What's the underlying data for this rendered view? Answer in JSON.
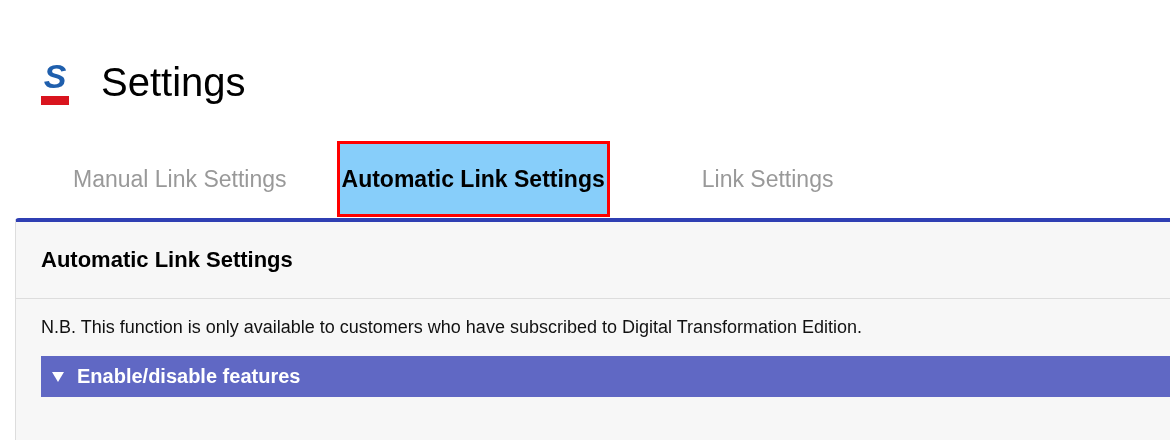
{
  "logo": {
    "letter": "S"
  },
  "title": "Settings",
  "tabs": [
    {
      "label": "Manual Link Settings",
      "selected": false
    },
    {
      "label": "Automatic Link Settings",
      "selected": true
    },
    {
      "label": "Link Settings",
      "selected": false
    }
  ],
  "panel": {
    "heading": "Automatic Link Settings",
    "note": "N.B. This function is only available to customers who have subscribed to Digital Transformation Edition.",
    "section": {
      "label": "Enable/disable features",
      "expanded": true
    }
  }
}
